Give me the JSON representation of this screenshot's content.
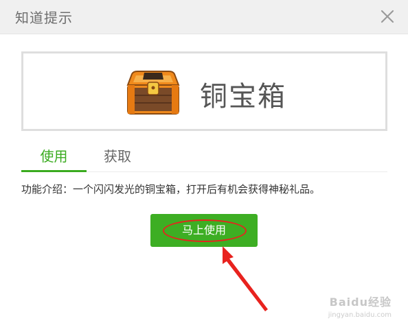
{
  "dialog": {
    "title": "知道提示",
    "close_icon": "close-icon"
  },
  "item": {
    "name": "铜宝箱",
    "icon": "treasure-chest-icon"
  },
  "tabs": [
    {
      "label": "使用",
      "active": true
    },
    {
      "label": "获取",
      "active": false
    }
  ],
  "description": "功能介绍：一个闪闪发光的铜宝箱，打开后有机会获得神秘礼品。",
  "action": {
    "use_now_label": "马上使用"
  },
  "watermark": {
    "text": "Baidu经验",
    "url_text": "jingyan.baidu.com"
  },
  "colors": {
    "accent_green": "#3dae23",
    "annotation_red": "#e8221e",
    "header_bg": "#f0f0f0"
  }
}
